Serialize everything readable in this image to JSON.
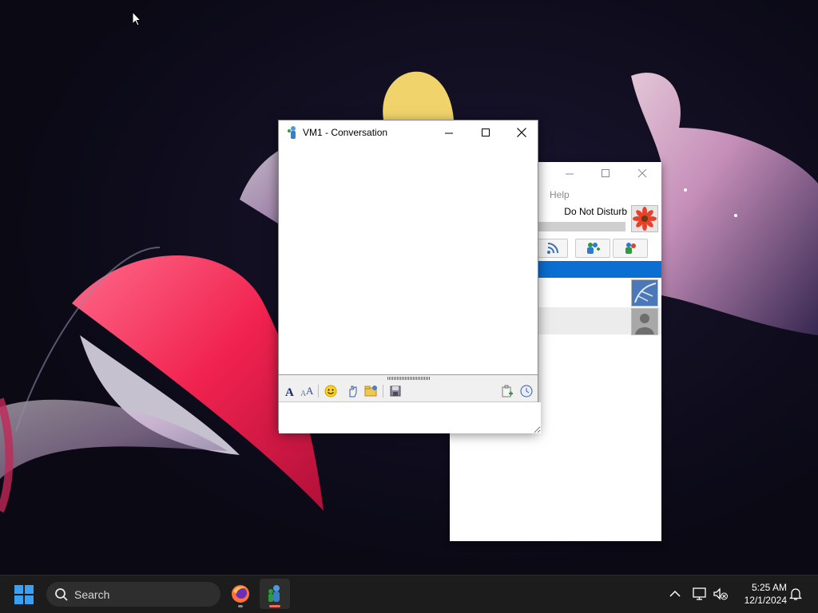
{
  "conversation_window": {
    "title": "VM1 - Conversation",
    "message_input": ""
  },
  "contact_list_window": {
    "menu_help": "Help",
    "status": "Do Not Disturb"
  },
  "taskbar": {
    "search_label": "Search",
    "time": "5:25 AM",
    "date": "12/1/2024",
    "apps": [
      "firefox-icon",
      "messenger-icon"
    ]
  },
  "colors": {
    "group_header": "#0a6fd1",
    "taskbar": "#1c1c1c",
    "start_blue": "#3aa0f3"
  }
}
